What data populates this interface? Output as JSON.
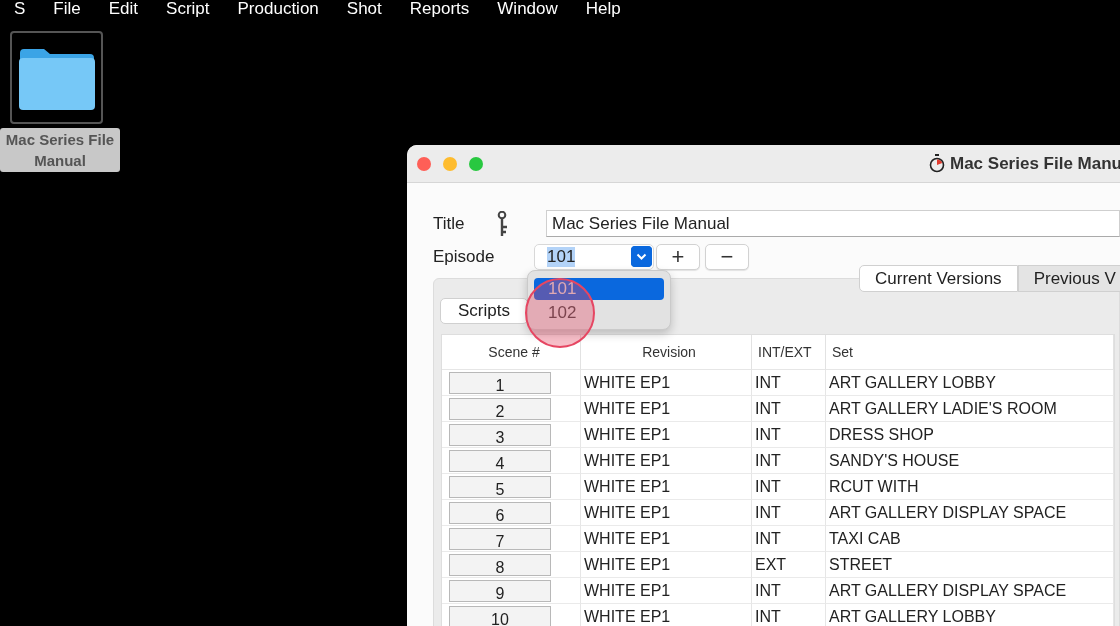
{
  "menu_bar": {
    "items": [
      "S",
      "File",
      "Edit",
      "Script",
      "Production",
      "Shot",
      "Reports",
      "Window",
      "Help"
    ]
  },
  "desktop_icon": {
    "label": "Mac Series File Manual",
    "selected": true
  },
  "window": {
    "title": "Mac Series File Manu",
    "title_field": {
      "label": "Title",
      "value": "Mac Series File Manual"
    },
    "episode": {
      "label": "Episode",
      "value": "101",
      "text_selected": true,
      "expanded": true,
      "options": [
        {
          "label": "101",
          "selected": true
        },
        {
          "label": "102",
          "selected": false
        }
      ],
      "buttons": [
        "+",
        "−"
      ]
    },
    "version_tabs": [
      {
        "label": "Current Versions",
        "selected": true
      },
      {
        "label": "Previous V",
        "selected": false
      }
    ],
    "scripts_button": "Scripts",
    "table": {
      "columns": [
        "Scene #",
        "Revision",
        "INT/EXT",
        "Set"
      ],
      "rows": [
        {
          "scene": "1",
          "revision": "WHITE EP1",
          "int_ext": "INT",
          "set": "ART GALLERY LOBBY"
        },
        {
          "scene": "2",
          "revision": "WHITE EP1",
          "int_ext": "INT",
          "set": "ART GALLERY LADIE'S ROOM"
        },
        {
          "scene": "3",
          "revision": "WHITE EP1",
          "int_ext": "INT",
          "set": "DRESS SHOP"
        },
        {
          "scene": "4",
          "revision": "WHITE EP1",
          "int_ext": "INT",
          "set": "SANDY'S HOUSE"
        },
        {
          "scene": "5",
          "revision": "WHITE EP1",
          "int_ext": "INT",
          "set": "RCUT WITH"
        },
        {
          "scene": "6",
          "revision": "WHITE EP1",
          "int_ext": "INT",
          "set": "ART GALLERY DISPLAY SPACE"
        },
        {
          "scene": "7",
          "revision": "WHITE EP1",
          "int_ext": "INT",
          "set": "TAXI CAB"
        },
        {
          "scene": "8",
          "revision": "WHITE EP1",
          "int_ext": "EXT",
          "set": "STREET"
        },
        {
          "scene": "9",
          "revision": "WHITE EP1",
          "int_ext": "INT",
          "set": "ART GALLERY DISPLAY SPACE"
        },
        {
          "scene": "10",
          "revision": "WHITE EP1",
          "int_ext": "INT",
          "set": "ART GALLERY LOBBY"
        }
      ]
    }
  }
}
